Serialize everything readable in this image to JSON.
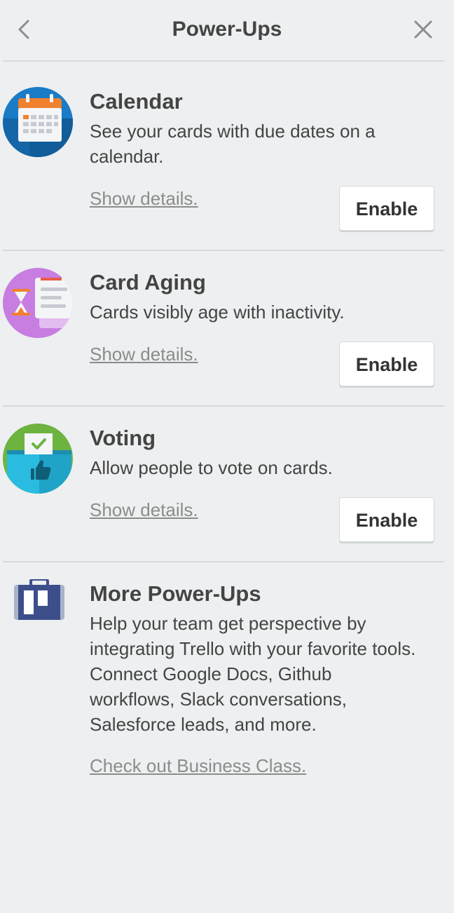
{
  "header": {
    "title": "Power-Ups"
  },
  "powerups": [
    {
      "title": "Calendar",
      "description": "See your cards with due dates on a calendar.",
      "details_label": "Show details.",
      "enable_label": "Enable"
    },
    {
      "title": "Card Aging",
      "description": "Cards visibly age with inactivity.",
      "details_label": "Show details.",
      "enable_label": "Enable"
    },
    {
      "title": "Voting",
      "description": "Allow people to vote on cards.",
      "details_label": "Show details.",
      "enable_label": "Enable"
    }
  ],
  "more": {
    "title": "More Power-Ups",
    "description": "Help your team get perspective by integrating Trello with your favorite tools. Connect Google Docs, Github workflows, Slack conversations, Salesforce leads, and more.",
    "link_label": "Check out Business Class."
  },
  "colors": {
    "background": "#edeff0",
    "divider": "#d6dadc",
    "text": "#444444",
    "link": "#8c8c8c",
    "calendar_blue": "#1a7bc7",
    "aging_purple": "#c77ee0",
    "voting_green": "#6db33f",
    "voting_teal": "#29bce0",
    "briefcase_navy": "#3d4f8a"
  }
}
